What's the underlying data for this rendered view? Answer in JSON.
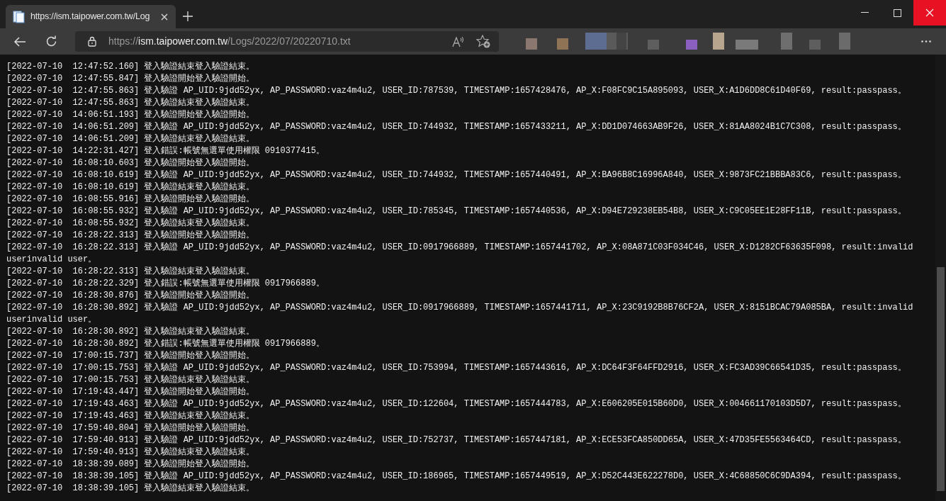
{
  "tab": {
    "title": "https://ism.taipower.com.tw/Log",
    "selected": true
  },
  "address": {
    "scheme": "https://",
    "host": "ism.taipower.com.tw",
    "path": "/Logs/2022/07/20220710.txt"
  },
  "lines": [
    "[2022-07-10  12:47:52.160] 登入驗證結束登入驗證結束。",
    "[2022-07-10  12:47:55.847] 登入驗證開始登入驗證開始。",
    "[2022-07-10  12:47:55.863] 登入驗證 AP_UID:9jdd52yx, AP_PASSWORD:vaz4m4u2, USER_ID:787539, TIMESTAMP:1657428476, AP_X:F08FC9C15A895093, USER_X:A1D6DD8C61D40F69, result:passpass。",
    "[2022-07-10  12:47:55.863] 登入驗證結束登入驗證結束。",
    "[2022-07-10  14:06:51.193] 登入驗證開始登入驗證開始。",
    "[2022-07-10  14:06:51.209] 登入驗證 AP_UID:9jdd52yx, AP_PASSWORD:vaz4m4u2, USER_ID:744932, TIMESTAMP:1657433211, AP_X:DD1D074663AB9F26, USER_X:81AA8024B1C7C308, result:passpass。",
    "[2022-07-10  14:06:51.209] 登入驗證結束登入驗證結束。",
    "[2022-07-10  14:22:31.427] 登入錯誤:帳號無選單使用權限 0910377415。",
    "[2022-07-10  16:08:10.603] 登入驗證開始登入驗證開始。",
    "[2022-07-10  16:08:10.619] 登入驗證 AP_UID:9jdd52yx, AP_PASSWORD:vaz4m4u2, USER_ID:744932, TIMESTAMP:1657440491, AP_X:BA96B8C16996A840, USER_X:9873FC21BBBA83C6, result:passpass。",
    "[2022-07-10  16:08:10.619] 登入驗證結束登入驗證結束。",
    "[2022-07-10  16:08:55.916] 登入驗證開始登入驗證開始。",
    "[2022-07-10  16:08:55.932] 登入驗證 AP_UID:9jdd52yx, AP_PASSWORD:vaz4m4u2, USER_ID:785345, TIMESTAMP:1657440536, AP_X:D94E729238EB54B8, USER_X:C9C05EE1E28FF11B, result:passpass。",
    "[2022-07-10  16:08:55.932] 登入驗證結束登入驗證結束。",
    "[2022-07-10  16:28:22.313] 登入驗證開始登入驗證開始。",
    "[2022-07-10  16:28:22.313] 登入驗證 AP_UID:9jdd52yx, AP_PASSWORD:vaz4m4u2, USER_ID:0917966889, TIMESTAMP:1657441702, AP_X:08A871C03F034C46, USER_X:D1282CF63635F098, result:invalid userinvalid user。",
    "[2022-07-10  16:28:22.313] 登入驗證結束登入驗證結束。",
    "[2022-07-10  16:28:22.329] 登入錯誤:帳號無選單使用權限 0917966889。",
    "[2022-07-10  16:28:30.876] 登入驗證開始登入驗證開始。",
    "[2022-07-10  16:28:30.892] 登入驗證 AP_UID:9jdd52yx, AP_PASSWORD:vaz4m4u2, USER_ID:0917966889, TIMESTAMP:1657441711, AP_X:23C9192B8B76CF2A, USER_X:8151BCAC79A085BA, result:invalid userinvalid user。",
    "[2022-07-10  16:28:30.892] 登入驗證結束登入驗證結束。",
    "[2022-07-10  16:28:30.892] 登入錯誤:帳號無選單使用權限 0917966889。",
    "[2022-07-10  17:00:15.737] 登入驗證開始登入驗證開始。",
    "[2022-07-10  17:00:15.753] 登入驗證 AP_UID:9jdd52yx, AP_PASSWORD:vaz4m4u2, USER_ID:753994, TIMESTAMP:1657443616, AP_X:DC64F3F64FFD2916, USER_X:FC3AD39C66541D35, result:passpass。",
    "[2022-07-10  17:00:15.753] 登入驗證結束登入驗證結束。",
    "[2022-07-10  17:19:43.447] 登入驗證開始登入驗證開始。",
    "[2022-07-10  17:19:43.463] 登入驗證 AP_UID:9jdd52yx, AP_PASSWORD:vaz4m4u2, USER_ID:122604, TIMESTAMP:1657444783, AP_X:E606205E015B60D0, USER_X:004661170103D5D7, result:passpass。",
    "[2022-07-10  17:19:43.463] 登入驗證結束登入驗證結束。",
    "[2022-07-10  17:59:40.804] 登入驗證開始登入驗證開始。",
    "[2022-07-10  17:59:40.913] 登入驗證 AP_UID:9jdd52yx, AP_PASSWORD:vaz4m4u2, USER_ID:752737, TIMESTAMP:1657447181, AP_X:ECE53FCA850DD65A, USER_X:47D35FE5563464CD, result:passpass。",
    "[2022-07-10  17:59:40.913] 登入驗證結束登入驗證結束。",
    "[2022-07-10  18:38:39.089] 登入驗證開始登入驗證開始。",
    "[2022-07-10  18:38:39.105] 登入驗證 AP_UID:9jdd52yx, AP_PASSWORD:vaz4m4u2, USER_ID:186965, TIMESTAMP:1657449519, AP_X:D52C443E622278D0, USER_X:4C68850C6C9DA394, result:passpass。",
    "[2022-07-10  18:38:39.105] 登入驗證結束登入驗證結束。"
  ]
}
